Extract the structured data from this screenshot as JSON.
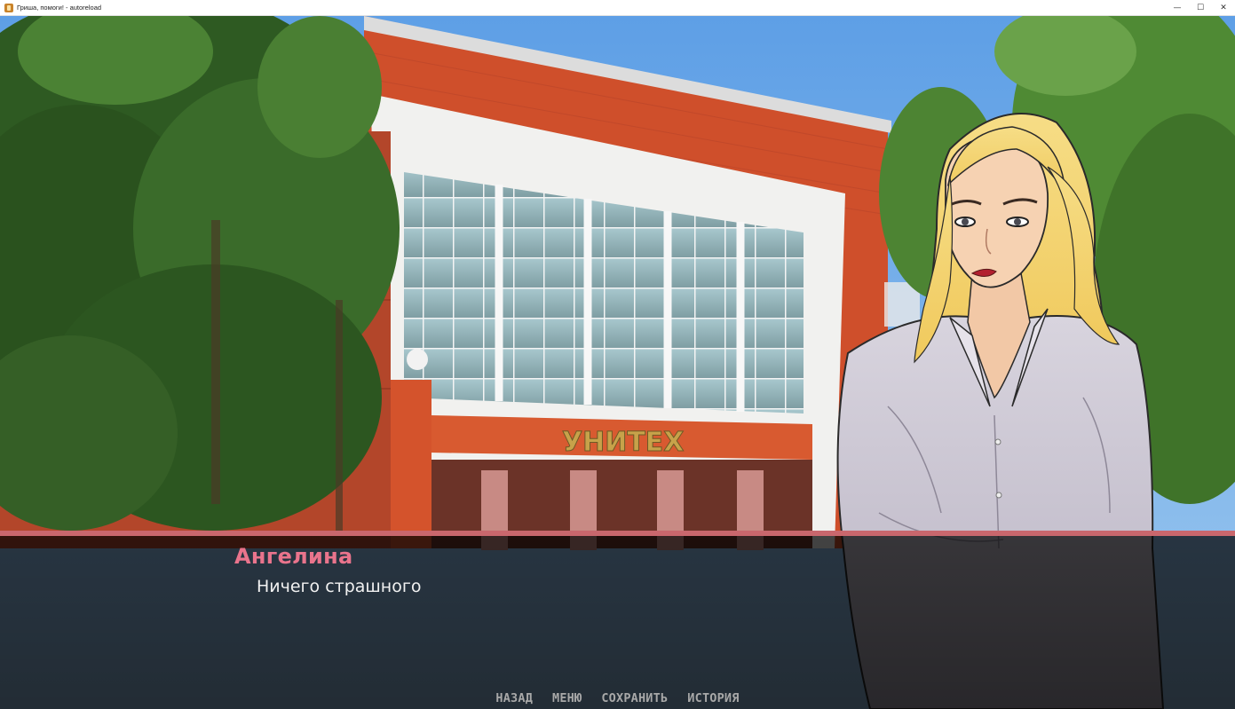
{
  "window": {
    "title": "Гриша, помоги! - autoreload",
    "minimize": "—",
    "maximize": "☐",
    "close": "✕"
  },
  "scene": {
    "building_sign": "УНИТЕХ",
    "colors": {
      "sky": "#6aa9e8",
      "brick": "#d4512b",
      "foliage": "#2f5a1f"
    }
  },
  "dialogue": {
    "speaker": "Ангелина",
    "text": "Ничего страшного",
    "accent": "#c9676d",
    "speaker_color": "#e9748c"
  },
  "quick_menu": [
    {
      "label": "назад"
    },
    {
      "label": "меню"
    },
    {
      "label": "сохранить"
    },
    {
      "label": "история"
    }
  ]
}
